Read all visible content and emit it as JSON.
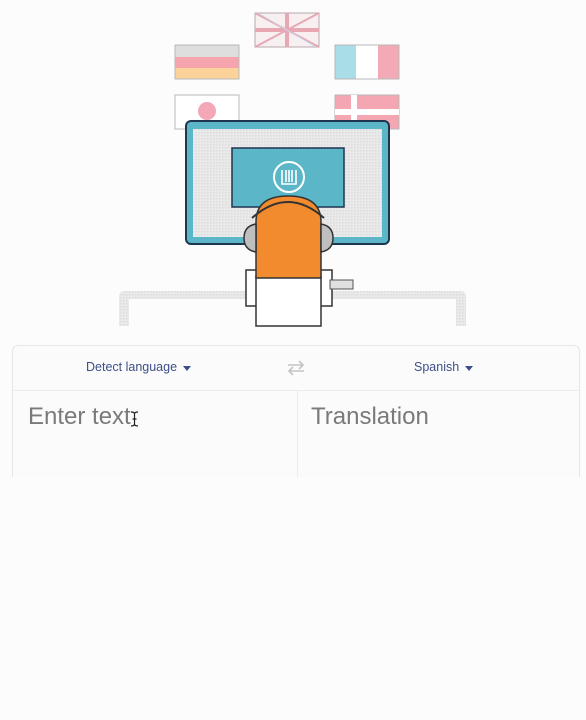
{
  "hero": {
    "flags": [
      "flag-uk-icon",
      "flag-germany-icon",
      "flag-france-icon",
      "flag-japan-icon",
      "flag-denmark-icon"
    ],
    "logo": "translate-logo-icon"
  },
  "translator": {
    "source_language": "Detect language",
    "target_language": "Spanish",
    "input_placeholder": "Enter text",
    "output_placeholder": "Translation"
  },
  "colors": {
    "accent": "#3d4f88",
    "monitor": "#5bb7c8",
    "monitor_outline": "#1f3550",
    "person": "#f28a2e",
    "placeholder": "#7a7a7a"
  }
}
